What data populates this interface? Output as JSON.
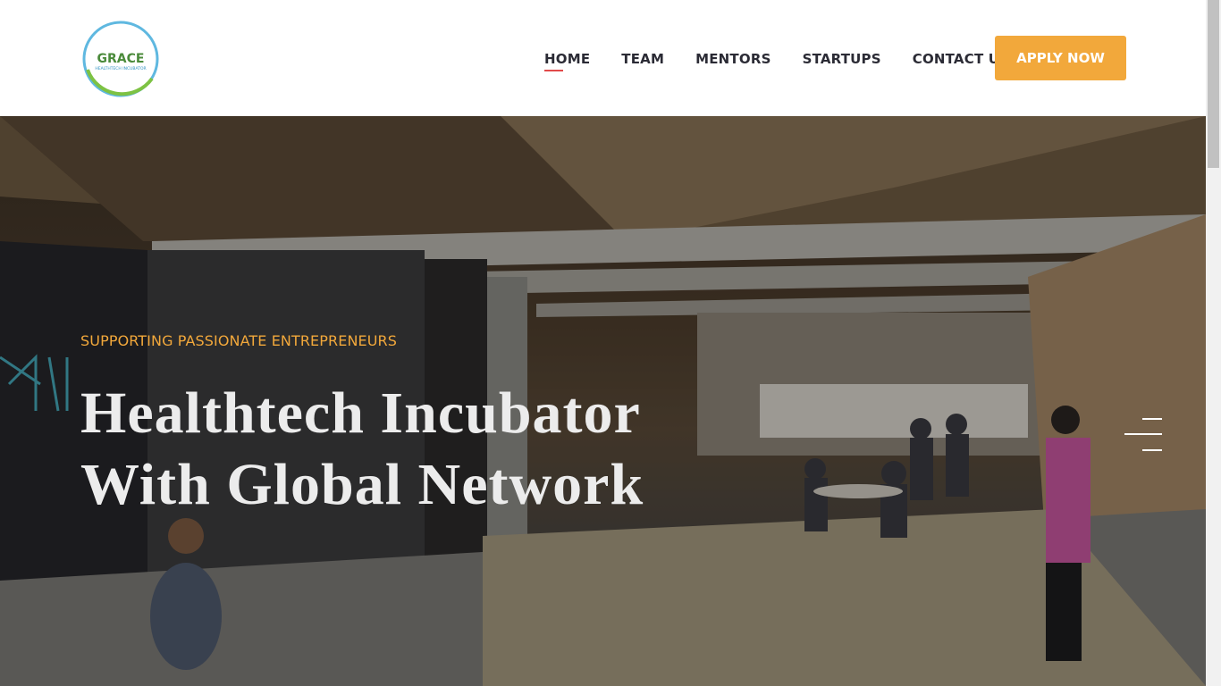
{
  "logo": {
    "text_main": "GRACE",
    "text_sub": "HEALTHTECH INCUBATOR"
  },
  "nav": {
    "items": [
      {
        "label": "HOME",
        "active": true
      },
      {
        "label": "TEAM",
        "active": false
      },
      {
        "label": "MENTORS",
        "active": false
      },
      {
        "label": "STARTUPS",
        "active": false
      },
      {
        "label": "CONTACT US",
        "active": false
      }
    ],
    "apply_label": "APPLY NOW"
  },
  "hero": {
    "tagline": "SUPPORTING PASSIONATE ENTREPRENEURS",
    "headline_line1": "Healthtech Incubator",
    "headline_line2": "With Global Network"
  },
  "colors": {
    "accent": "#f2a83b",
    "active_underline": "#e24a4a",
    "nav_text": "#2b2b35"
  },
  "icons": {
    "menu": "hamburger-icon"
  }
}
